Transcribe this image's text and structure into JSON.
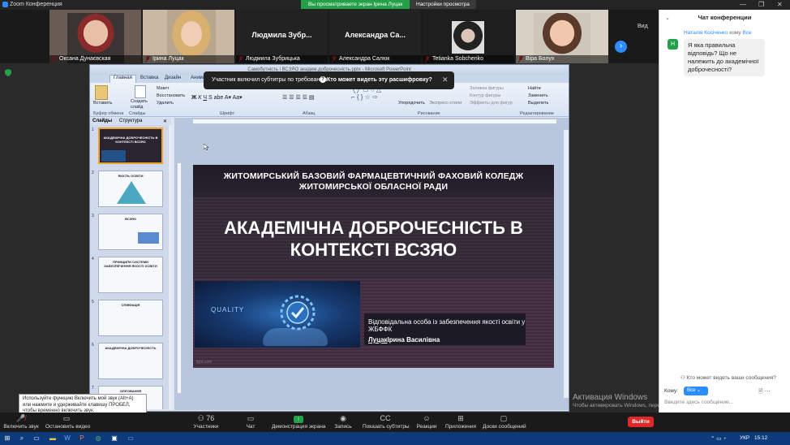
{
  "titlebar": {
    "app_name": "Zoom Конференция",
    "share_banner": "Вы просматриваете экран Ірина Луцак",
    "view_options": "Настройки просмотра",
    "min": "—",
    "max": "❐",
    "close": "✕"
  },
  "gallery": {
    "view_label": "Вид",
    "participants": [
      {
        "name": "Оксана Дунаєвская",
        "video": true
      },
      {
        "name": "Ірина Луцак",
        "video": true
      },
      {
        "name": "Людмила Зубрицька",
        "video": false,
        "big_name": "Людмила Зубр..."
      },
      {
        "name": "Александра Салюк",
        "video": false,
        "big_name": "Александра Са..."
      },
      {
        "name": "Tetianka Sobchenko",
        "video": true
      },
      {
        "name": "Віра Болух",
        "video": true
      }
    ],
    "next_label": "›"
  },
  "ppt": {
    "window_title": "Самобутність і ВСЗЯО академ.доброчесність.pptx - Microsoft PowerPoint",
    "tabs": [
      "Главная",
      "Вставка",
      "Дизайн",
      "Анимация"
    ],
    "ribbon": {
      "paste": "Вставить",
      "create_slide": "Создать слайд",
      "layout": "Макет",
      "reset": "Восстановить",
      "delete": "Удалить",
      "arrange": "Упорядочить",
      "quick_styles": "Экспресс-стили",
      "find": "Найти",
      "replace": "Заменить",
      "select": "Выделить",
      "shape_fill": "Заливка фигуры",
      "shape_outline": "Контур фигуры",
      "shape_effects": "Эффекты для фигур",
      "groups": [
        "Буфер обмена",
        "Слайды",
        "Шрифт",
        "Абзац",
        "Рисование",
        "Редактирование"
      ]
    },
    "pane_tabs": [
      "Слайды",
      "Структура"
    ],
    "thumbnails": [
      {
        "num": "1",
        "title": "АКАДЕМІЧНА ДОБРОЧЕСНІСТЬ В КОНТЕКСТІ ВСЗЯО"
      },
      {
        "num": "2",
        "title": "ЯКІСТЬ ОСВІТИ"
      },
      {
        "num": "3",
        "title": "ВСЗЯО"
      },
      {
        "num": "4",
        "title": "ПРИНЦИПИ СИСТЕМИ ЗАБЕЗПЕЧЕННЯ ЯКОСТІ ОСВІТИ"
      },
      {
        "num": "5",
        "title": "СПІВФАЦІЯ"
      },
      {
        "num": "6",
        "title": "АКАДЕМІЧНА ДОБРОЧЕСНІСТЬ"
      },
      {
        "num": "7",
        "title": "ОЛІГОВАННЯ"
      }
    ],
    "slide": {
      "college": "ЖИТОМИРСЬКИЙ БАЗОВИЙ ФАРМАЦЕВТИЧНИЙ ФАХОВИЙ КОЛЕДЖ ЖИТОМИРСЬКОЇ ОБЛАСНОЇ РАДИ",
      "title": "АКАДЕМІЧНА ДОБРОЧЕСНІСТЬ В КОНТЕКСТІ ВСЗЯО",
      "image_label": "QUALITY",
      "resp_line": "Відповідальна особа із забезпечення якості освіти у ЖБФФК",
      "resp_surname": "Луцак",
      "resp_name": "Ірина Василівна",
      "footer": "fppt.com"
    }
  },
  "subtitle_banner": {
    "notice": "Участник включил субтитры по требованию",
    "question": "Кто может видеть эту расшифровку?",
    "close": "✕"
  },
  "chat": {
    "title": "Чат конференции",
    "sender": "Наталія Косіченко",
    "to_label": "кому",
    "to_target": "Все",
    "avatar_letter": "Н",
    "message": "Я яка правильна відповідь? Що не належить до академічної доброчесності?",
    "who_can": "Кто может видеть ваши сообщения?",
    "to_field_label": "Кому:",
    "to_field_value": "Все",
    "input_placeholder": "Введите здесь сообщение..."
  },
  "activation": {
    "title": "Активация Windows",
    "sub": "Чтобы активировать Windows, перейдите в раздел \"Параметры\"."
  },
  "tooltip": {
    "text": "Используйте функцию Включить мой звук (Alt+A) или нажмите и удерживайте клавишу ПРОБЕЛ, чтобы временно включить звук."
  },
  "toolbar": {
    "unmute": "Включить звук",
    "stop_video": "Остановить видео",
    "participants": "Участники",
    "participants_count": "76",
    "chat": "Чат",
    "share": "Демонстрация экрана",
    "record": "Запись",
    "captions": "Показать субтитры",
    "reactions": "Реакции",
    "apps": "Приложения",
    "whiteboards": "Доски сообщений",
    "leave": "Выйти"
  },
  "taskbar": {
    "lang": "УКР",
    "time": "15:12"
  }
}
